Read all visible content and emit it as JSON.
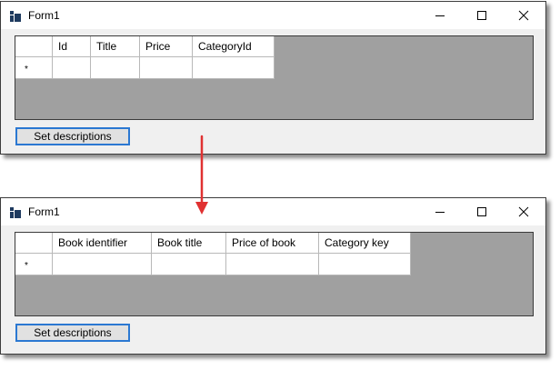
{
  "windows": [
    {
      "title": "Form1",
      "columns": [
        "Id",
        "Title",
        "Price",
        "CategoryId"
      ],
      "new_row_marker": "*",
      "button_label": "Set descriptions"
    },
    {
      "title": "Form1",
      "columns": [
        "Book identifier",
        "Book title",
        "Price of book",
        "Category key"
      ],
      "new_row_marker": "*",
      "button_label": "Set descriptions"
    }
  ],
  "icons": {
    "app": "app-form-icon",
    "minimize": "minimize-icon",
    "maximize": "maximize-icon",
    "close": "close-icon",
    "transition_arrow": "arrow-down-icon"
  },
  "colors": {
    "grid_background": "#a0a0a0",
    "button_border": "#2b78d2",
    "arrow": "#e03131"
  }
}
